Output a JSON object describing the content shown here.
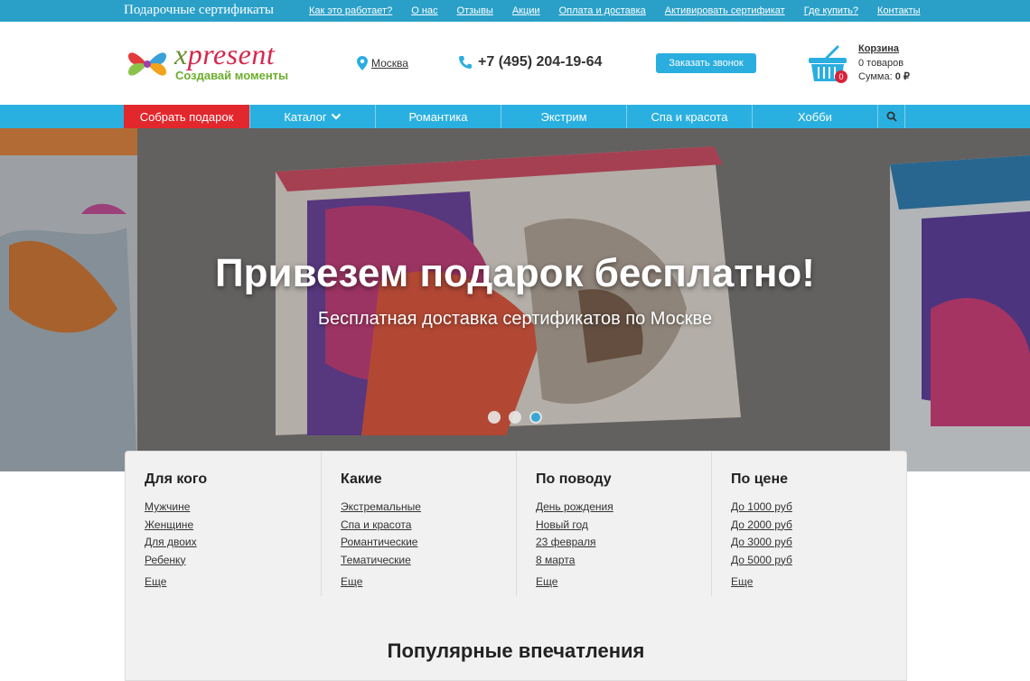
{
  "topbar": {
    "title": "Подарочные сертификаты",
    "links": [
      "Как это работает?",
      "О нас",
      "Отзывы",
      "Акции",
      "Оплата и доставка",
      "Активировать сертификат",
      "Где купить?",
      "Контакты"
    ]
  },
  "header": {
    "logo_word_x": "x",
    "logo_word_rest": "present",
    "logo_tagline": "Создавай моменты",
    "city": "Москва",
    "phone": "+7 (495) 204-19-64",
    "callback_label": "Заказать звонок",
    "cart": {
      "title": "Корзина",
      "count_badge": "0",
      "items_line": "0 товаров",
      "sum_prefix": "Сумма: ",
      "sum_value": "0 ₽"
    }
  },
  "nav": {
    "items": [
      "Собрать подарок",
      "Каталог",
      "Романтика",
      "Экстрим",
      "Спа и красота",
      "Хобби"
    ]
  },
  "hero": {
    "title": "Привезем подарок бесплатно!",
    "subtitle": "Бесплатная доставка сертификатов по Москве",
    "slides_total": 3,
    "active_slide": 3
  },
  "filters": [
    {
      "heading": "Для кого",
      "items": [
        "Мужчине",
        "Женщине",
        "Для двоих",
        "Ребенку"
      ],
      "more": "Еще"
    },
    {
      "heading": "Какие",
      "items": [
        "Экстремальные",
        "Спа и красота",
        "Романтические",
        "Тематические"
      ],
      "more": "Еще"
    },
    {
      "heading": "По поводу",
      "items": [
        "День рождения",
        "Новый год",
        "23 февраля",
        "8 марта"
      ],
      "more": "Еще"
    },
    {
      "heading": "По цене",
      "items": [
        "До 1000 руб",
        "До 2000 руб",
        "До 3000 руб",
        "До 5000 руб"
      ],
      "more": "Еще"
    }
  ],
  "popular_heading": "Популярные впечатления",
  "colors": {
    "topbar": "#2aa0c9",
    "nav": "#2ab0e0",
    "nav_active": "#e2272d",
    "callback": "#2aaee0",
    "logo_red": "#d6274c",
    "logo_green": "#6cae2d"
  },
  "icons": [
    "location-pin-icon",
    "phone-icon",
    "basket-icon",
    "chevron-down-icon",
    "search-icon",
    "logo-mark-icon"
  ]
}
